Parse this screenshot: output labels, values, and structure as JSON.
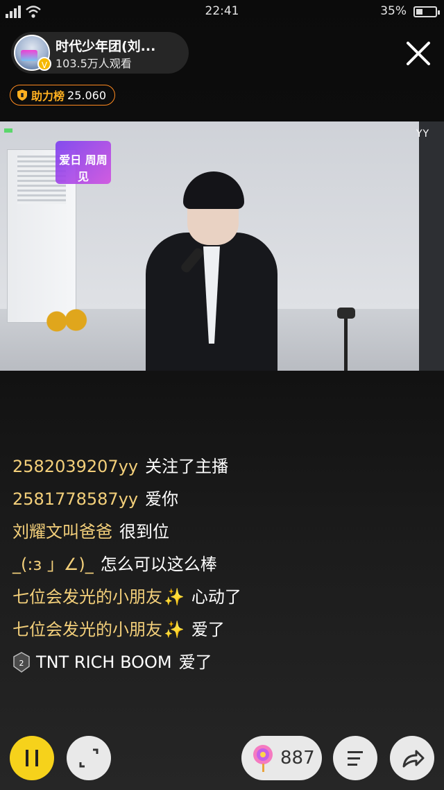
{
  "status_bar": {
    "time": "22:41",
    "battery": "35%",
    "battery_level": 0.35
  },
  "anchor": {
    "name": "时代少年团(刘...",
    "viewers": "103.5万人观看",
    "verified": "V"
  },
  "rank": {
    "label": "助力榜",
    "value": "25.060"
  },
  "video": {
    "watermark": "YY",
    "overlay_logo": "爱日 周周见"
  },
  "chat": [
    {
      "user": "2582039207yy",
      "text": "关注了主播"
    },
    {
      "user": "2581778587yy",
      "text": "爱你"
    },
    {
      "user": "刘耀文叫爸爸",
      "text": "很到位"
    },
    {
      "user": "_(:з 」∠)_",
      "text": "怎么可以这么棒"
    },
    {
      "user": "七位会发光的小朋友",
      "sparkle": "✨",
      "text": "心动了"
    },
    {
      "user": "七位会发光的小朋友",
      "sparkle": "✨",
      "text": "爱了"
    },
    {
      "user": "TNT RICH BOOM",
      "text": "爱了",
      "level_badge": "2"
    }
  ],
  "controls": {
    "gift_count": "887"
  },
  "icons": [
    "wifi-icon",
    "battery-icon",
    "close-icon",
    "shield-icon",
    "pause-icon",
    "fullscreen-icon",
    "lollipop-icon",
    "menu-icon",
    "share-icon",
    "level-badge-icon"
  ],
  "colors": {
    "accent_yellow": "#f6d21b",
    "rank_orange": "#ff8a1f",
    "chat_user": "#f3cf7a"
  }
}
